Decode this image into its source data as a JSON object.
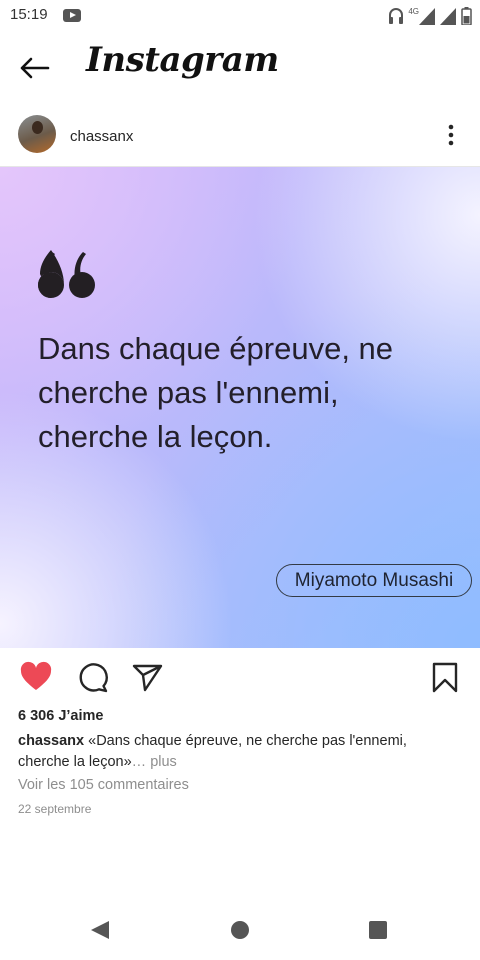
{
  "status_bar": {
    "time": "15:19",
    "network": "4G"
  },
  "app": {
    "title": "Instagram"
  },
  "post": {
    "username": "chassanx",
    "quote": "Dans chaque épreuve, ne cherche pas l'ennemi, cherche la leçon.",
    "author": "Miyamoto Musashi",
    "liked": true,
    "like_count": "6 306 J’aime",
    "caption_username": "chassanx",
    "caption_text": "«Dans chaque épreuve, ne cherche pas l'ennemi, cherche la leçon»",
    "caption_more": "… plus",
    "view_comments": "Voir les 105 commentaires",
    "date": "22 septembre"
  },
  "colors": {
    "like_red": "#ed4956",
    "muted_text": "#8e8e8e"
  },
  "icons": [
    "back-arrow-icon",
    "more-vertical-icon",
    "heart-icon",
    "comment-icon",
    "share-icon",
    "bookmark-icon",
    "nav-back-icon",
    "nav-home-icon",
    "nav-recents-icon"
  ]
}
